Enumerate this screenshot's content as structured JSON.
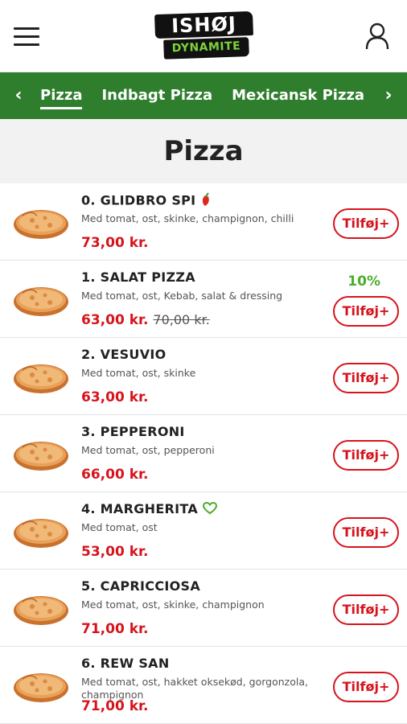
{
  "header": {
    "menu_icon": "hamburger-icon",
    "logo_top": "ISHØJ",
    "logo_bottom": "DYNAMITE",
    "user_icon": "user-icon"
  },
  "category_nav": {
    "prev_icon": "chevron-left-icon",
    "next_icon": "chevron-right-icon",
    "tabs": [
      {
        "label": "Pizza",
        "active": true
      },
      {
        "label": "Indbagt Pizza",
        "active": false
      },
      {
        "label": "Mexicansk Pizza",
        "active": false
      }
    ]
  },
  "section_title": "Pizza",
  "add_label": "Tilføj+",
  "colors": {
    "nav_green": "#2f7e2e",
    "price_red": "#d6141d",
    "discount_green": "#4aae2a"
  },
  "items": [
    {
      "name": "0. GLIDBRO SPI",
      "icon": "chili-icon",
      "desc": "Med tomat, ost, skinke, champignon, chilli",
      "price": "73,00 kr."
    },
    {
      "name": "1. SALAT PIZZA",
      "desc": "Med tomat, ost, Kebab, salat & dressing",
      "price": "63,00 kr.",
      "old_price": "70,00 kr.",
      "discount": "10%"
    },
    {
      "name": "2. VESUVIO",
      "desc": "Med tomat, ost, skinke",
      "price": "63,00 kr."
    },
    {
      "name": "3. PEPPERONI",
      "desc": "Med tomat, ost, pepperoni",
      "price": "66,00 kr."
    },
    {
      "name": "4. MARGHERITA",
      "icon": "vegetarian-heart-icon",
      "desc": "Med tomat, ost",
      "price": "53,00 kr."
    },
    {
      "name": "5. CAPRICCIOSA",
      "desc": "Med tomat, ost, skinke, champignon",
      "price": "71,00 kr."
    },
    {
      "name": "6. REW SAN",
      "desc": "Med tomat, ost, hakket oksekød, gorgonzola, champignon",
      "price": "71,00 kr."
    }
  ]
}
